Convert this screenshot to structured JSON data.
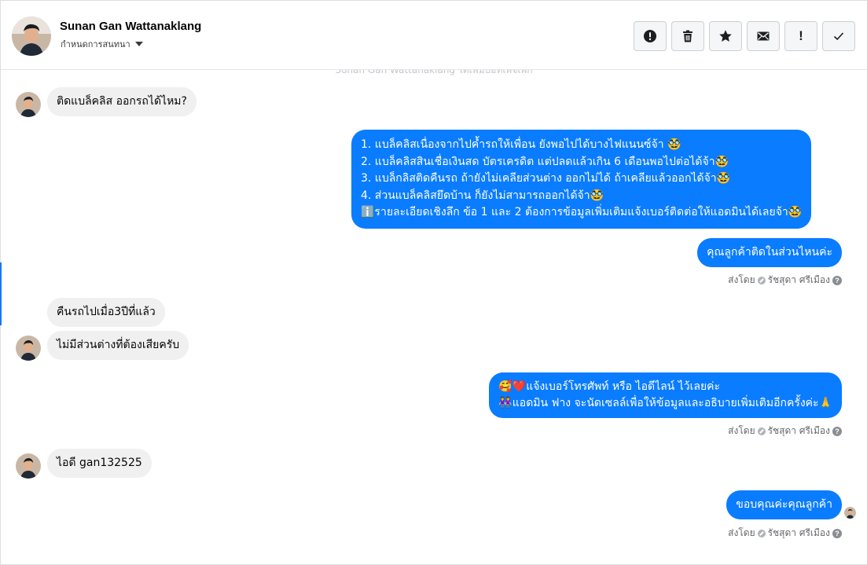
{
  "header": {
    "contact_name": "Sunan Gan Wattanaklang",
    "sub_label": "กำหนดการสนทนา",
    "actions": [
      {
        "name": "mark-spam-button",
        "icon": "alert-circle-icon"
      },
      {
        "name": "delete-button",
        "icon": "trash-icon"
      },
      {
        "name": "star-button",
        "icon": "star-icon"
      },
      {
        "name": "mark-unread-button",
        "icon": "envelope-icon"
      },
      {
        "name": "follow-up-button",
        "icon": "exclamation-icon",
        "label": "!"
      },
      {
        "name": "mark-done-button",
        "icon": "check-icon"
      }
    ]
  },
  "thread": {
    "faded_note": "Sunan Gan Wattanaklang ได้เพิ่มบอทเพจเพ็ก",
    "messages": [
      {
        "from": "customer",
        "text": "ติดแบล็คลิส ออกรถได้ไหม?"
      },
      {
        "from": "page",
        "lines": [
          "1. แบล็คลิสเนื่องจากไปค้ำรถให้เพื่อน ยังพอไปได้บางไฟแนนซ์จ้า 🥸",
          "2. แบล็คลิสสินเชื่อเงินสด บัตรเครดิต แต่ปลดแล้วเกิน 6 เดือนพอไปต่อได้จ้า🥸",
          "3. แบล็กลิสติดคืนรถ ถ้ายังไม่เคลียส่วนต่าง ออกไม่ได้ ถ้าเคลียแล้วออกได้จ้า🥸",
          "4. ส่วนแบล็คลิสยึดบ้าน ก็ยังไม่สามารถออกได้จ้า🥸",
          "ℹ️รายละเอียดเชิงลึก ข้อ 1 และ 2 ต้องการข้อมูลเพิ่มเติมแจ้งเบอร์ติดต่อให้แอดมินได้เลยจ้า🥸"
        ]
      },
      {
        "from": "page",
        "text": "คุณลูกค้าติดในส่วนไหนค่ะ"
      },
      {
        "from": "customer",
        "text": "คืนรถไปเมื่อ3ปีที่แล้ว"
      },
      {
        "from": "customer",
        "text": "ไม่มีส่วนต่างที่ต้องเสียครับ"
      },
      {
        "from": "page",
        "lines": [
          "🥰❤️แจ้งเบอร์โทรศัพท์ หรือ ไอดีไลน์  ไว้เลยค่ะ",
          "👭แอดมิน ฟาง จะนัดเซลล์เพื่อให้ข้อมูลและอธิบายเพิ่มเติมอีกครั้งค่ะ🙏"
        ]
      },
      {
        "from": "customer",
        "text": "ไอดี gan132525"
      },
      {
        "from": "page",
        "text": "ขอบคุณค่ะคุณลูกค้า"
      }
    ],
    "sent_by": {
      "prefix": "ส่งโดย",
      "agent": "รัชสุดา ศรีเมือง"
    }
  },
  "colors": {
    "outgoing_bubble": "#0a7cff",
    "incoming_bubble": "#f0f0f0",
    "accent": "#1877f2"
  }
}
